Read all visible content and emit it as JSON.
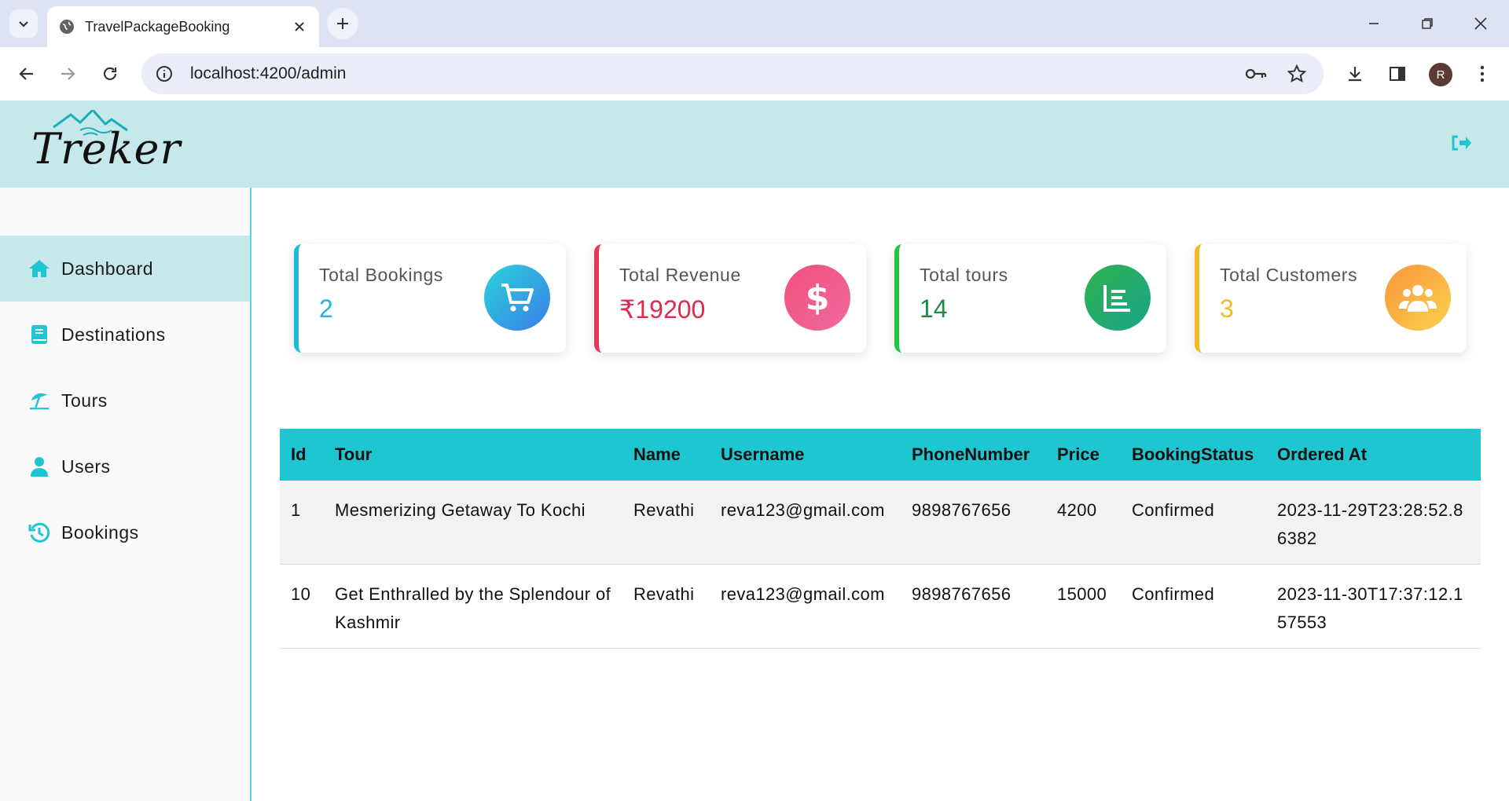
{
  "browser": {
    "tab_title": "TravelPackageBooking",
    "url": "localhost:4200/admin",
    "profile_initial": "R"
  },
  "app": {
    "logo_text": "Treker"
  },
  "sidebar": {
    "items": [
      {
        "label": "Dashboard",
        "icon": "home-icon",
        "active": true
      },
      {
        "label": "Destinations",
        "icon": "book-icon",
        "active": false
      },
      {
        "label": "Tours",
        "icon": "beach-umbrella-icon",
        "active": false
      },
      {
        "label": "Users",
        "icon": "user-icon",
        "active": false
      },
      {
        "label": "Bookings",
        "icon": "history-icon",
        "active": false
      }
    ]
  },
  "stats": [
    {
      "title": "Total Bookings",
      "value": "2",
      "icon": "cart-icon",
      "color": "#1fb8d6"
    },
    {
      "title": "Total Revenue",
      "value": "₹19200",
      "icon": "dollar-icon",
      "color": "#e8365a"
    },
    {
      "title": "Total tours",
      "value": "14",
      "icon": "chart-icon",
      "color": "#23a455"
    },
    {
      "title": "Total Customers",
      "value": "3",
      "icon": "users-icon",
      "color": "#f5b82a"
    }
  ],
  "bookings_table": {
    "headers": [
      "Id",
      "Tour",
      "Name",
      "Username",
      "PhoneNumber",
      "Price",
      "BookingStatus",
      "Ordered At"
    ],
    "rows": [
      [
        "1",
        "Mesmerizing Getaway To Kochi",
        "Revathi",
        "reva123@gmail.com",
        "9898767656",
        "4200",
        "Confirmed",
        "2023-11-29T23:28:52.86382"
      ],
      [
        "10",
        "Get Enthralled by the Splendour of Kashmir",
        "Revathi",
        "reva123@gmail.com",
        "9898767656",
        "15000",
        "Confirmed",
        "2023-11-30T17:37:12.157553"
      ]
    ]
  },
  "colors": {
    "accent": "#1ec6d1",
    "header_bg": "#c6e8ea"
  }
}
